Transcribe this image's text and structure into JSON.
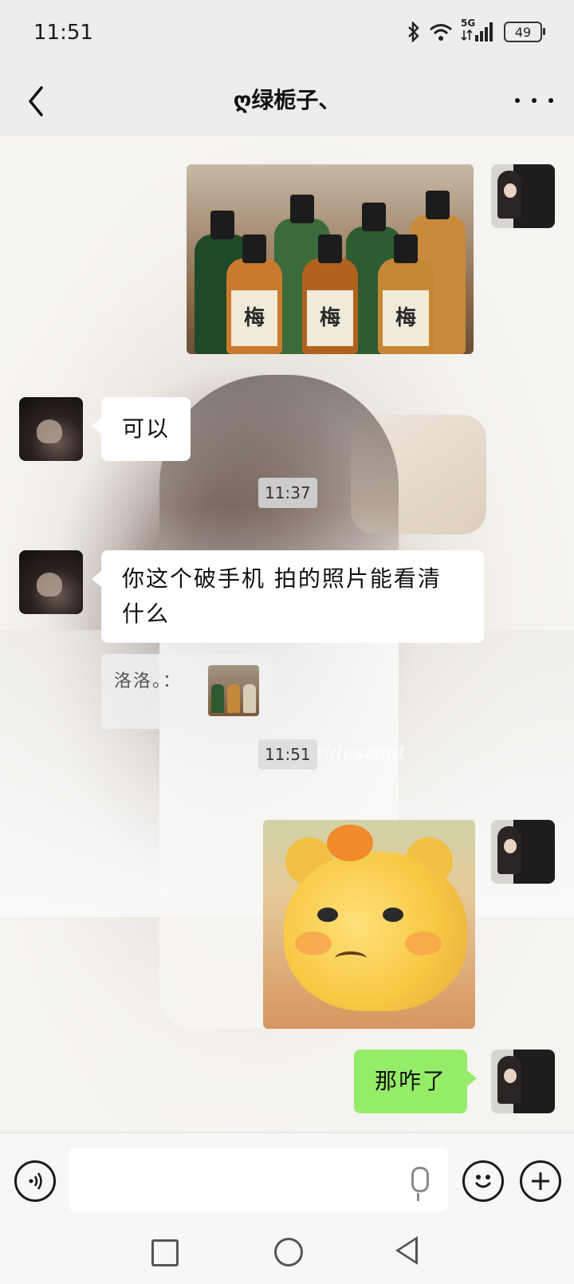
{
  "status_bar": {
    "time": "11:51",
    "network": "5G",
    "battery": "49",
    "icons": [
      "bluetooth-icon",
      "wifi-icon",
      "signal-icon",
      "battery-icon"
    ]
  },
  "header": {
    "title": "ღ绿栀子、",
    "back_icon": "chevron-left-icon",
    "more_icon": "more-dots-icon"
  },
  "messages": [
    {
      "side": "right",
      "type": "image",
      "image": "photo of plum wine bottles"
    },
    {
      "side": "left",
      "type": "text",
      "text": "可以"
    },
    {
      "type": "time",
      "text": "11:37"
    },
    {
      "side": "left",
      "type": "text",
      "text_line1": "你这个破手机 拍的照片能看清",
      "text_line2": "什么"
    },
    {
      "type": "quote",
      "text": "洛洛。："
    },
    {
      "type": "time",
      "text": "11:51"
    },
    {
      "side": "right",
      "type": "image",
      "image": "angry yellow bear sticker"
    },
    {
      "side": "right",
      "type": "text",
      "text": "那咋了"
    }
  ],
  "bottle_label": "梅",
  "background_watermark": "iridescent",
  "input_bar": {
    "voice_icon": "voice-icon",
    "mic_icon": "microphone-icon",
    "emoji_icon": "emoji-icon",
    "plus_icon": "plus-icon"
  },
  "system_nav": [
    "recent-apps-icon",
    "home-icon",
    "back-icon"
  ],
  "colors": {
    "sent_bubble": "#95ec69",
    "received_bubble": "#ffffff",
    "background": "#ededed"
  }
}
